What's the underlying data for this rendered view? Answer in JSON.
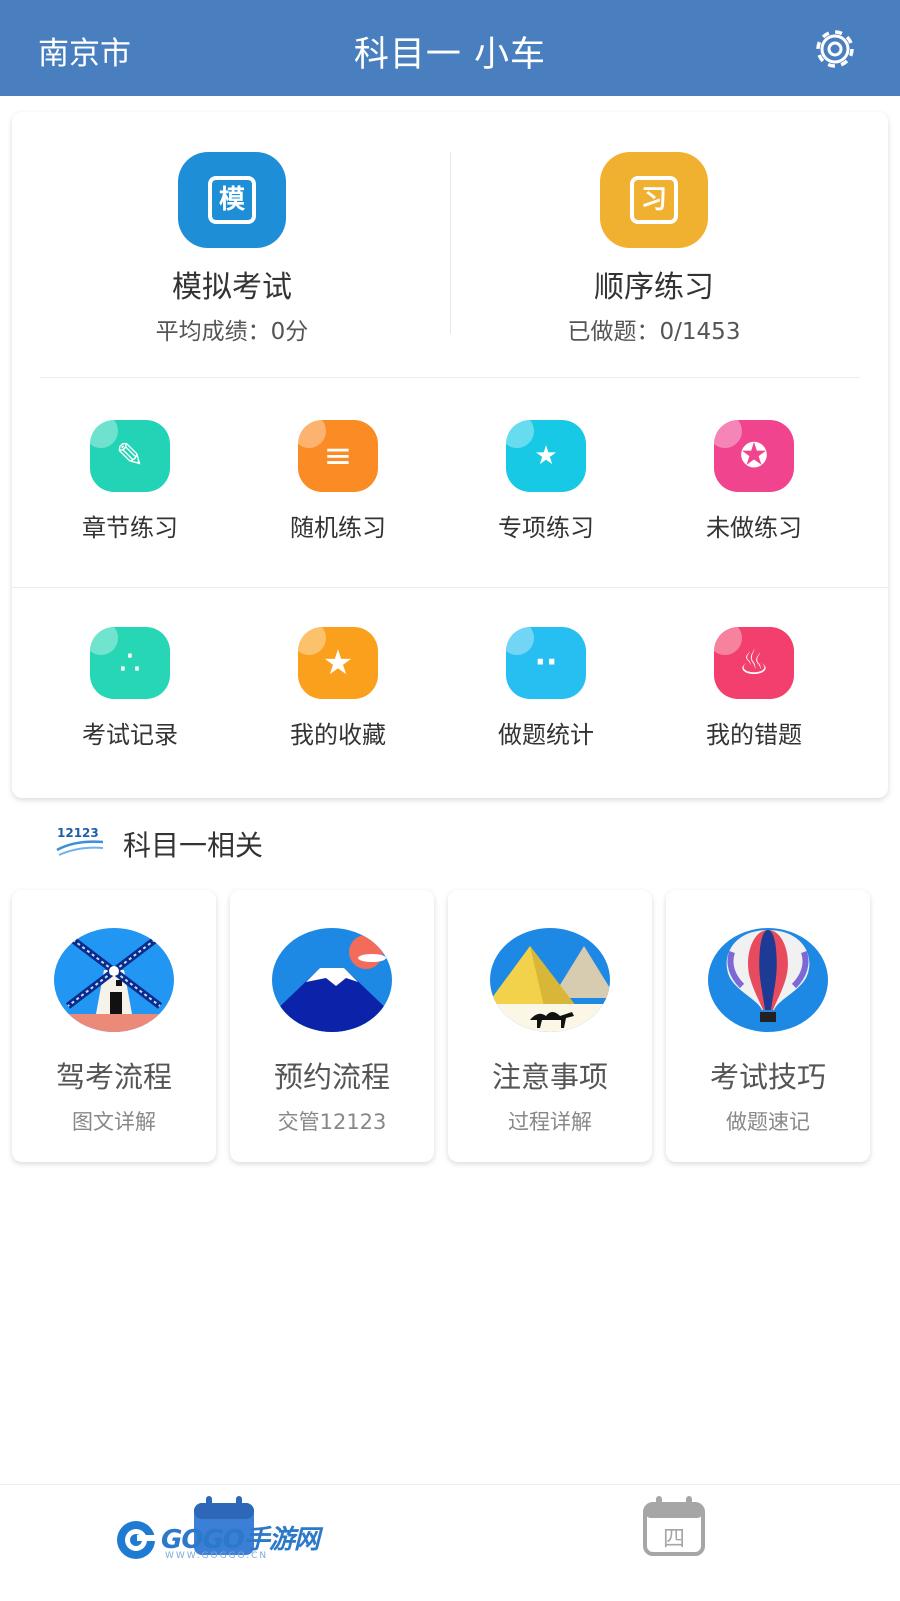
{
  "header": {
    "city": "南京市",
    "title": "科目一 小车"
  },
  "main": {
    "exam": {
      "label": "模拟考试",
      "subtitle": "平均成绩：0分",
      "icon_glyph": "模",
      "color": "#1e8fd6"
    },
    "sequence": {
      "label": "顺序练习",
      "subtitle": "已做题：0/1453",
      "icon_glyph": "习",
      "color": "#f1b130"
    }
  },
  "grid": [
    {
      "label": "章节练习",
      "icon": "pencil-icon",
      "glyph": "✎",
      "color": "#22d3b6"
    },
    {
      "label": "随机练习",
      "icon": "ticket-icon",
      "glyph": "≡",
      "color": "#fb8b24"
    },
    {
      "label": "专项练习",
      "icon": "shield-icon",
      "glyph": "★",
      "color": "#18c9e6"
    },
    {
      "label": "未做练习",
      "icon": "award-icon",
      "glyph": "✪",
      "color": "#f0448f"
    },
    {
      "label": "考试记录",
      "icon": "footprint-icon",
      "glyph": "∴",
      "color": "#26d6b5"
    },
    {
      "label": "我的收藏",
      "icon": "star-icon",
      "glyph": "★",
      "color": "#fba01c"
    },
    {
      "label": "做题统计",
      "icon": "chat-icon",
      "glyph": "··",
      "color": "#27bff2"
    },
    {
      "label": "我的错题",
      "icon": "flame-icon",
      "glyph": "♨",
      "color": "#f23f6e"
    }
  ],
  "related": {
    "logo_text": "12123",
    "title": "科目一相关",
    "cards": [
      {
        "label": "驾考流程",
        "sub": "图文详解"
      },
      {
        "label": "预约流程",
        "sub": "交管12123"
      },
      {
        "label": "注意事项",
        "sub": "过程详解"
      },
      {
        "label": "考试技巧",
        "sub": "做题速记"
      }
    ]
  },
  "bottom": {
    "tab2_glyph": "四",
    "watermark": {
      "text": "GOGO手游网",
      "url": "WWW.GOGGO.CN"
    }
  }
}
